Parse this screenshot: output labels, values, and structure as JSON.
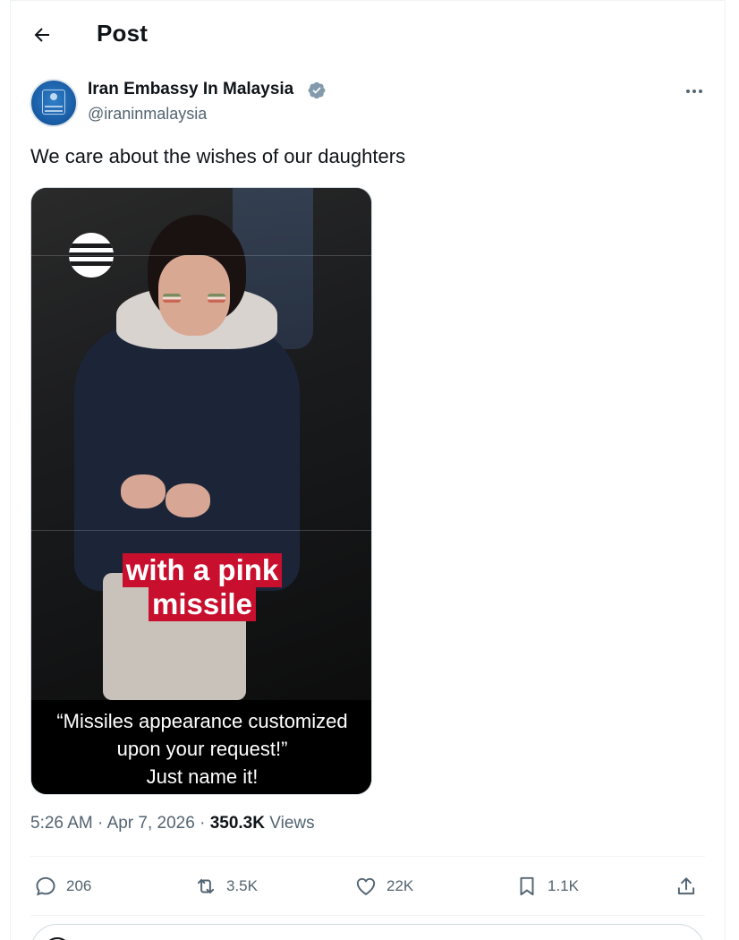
{
  "header": {
    "title": "Post"
  },
  "author": {
    "name": "Iran Embassy In Malaysia",
    "handle": "@iraninmalaysia",
    "verified": true
  },
  "post": {
    "text": "We care about the wishes of our daughters",
    "media": {
      "overlay_caption": [
        "with a pink",
        "missile"
      ],
      "bottom_caption": [
        "“Missiles appearance customized",
        "upon your request!”",
        "Just name it!"
      ]
    },
    "time": "5:26 AM",
    "separator": "·",
    "date": "Apr 7, 2026",
    "views_count": "350.3K",
    "views_label": "Views"
  },
  "actions": {
    "replies": "206",
    "reposts": "3.5K",
    "likes": "22K",
    "bookmarks": "1.1K"
  },
  "colors": {
    "text_primary": "#0f1419",
    "text_secondary": "#536471",
    "verified_badge": "#829aab",
    "caption_highlight": "#c8102e",
    "divider": "#eff3f4"
  },
  "icons": {
    "back": "arrow-left-icon",
    "verified": "verified-badge-icon",
    "more": "more-horizontal-icon",
    "reply": "reply-bubble-icon",
    "repost": "repost-icon",
    "like": "heart-icon",
    "bookmark": "bookmark-icon",
    "share": "share-icon"
  }
}
